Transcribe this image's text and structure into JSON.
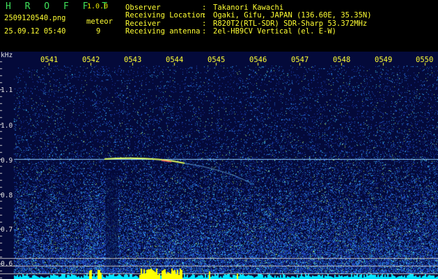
{
  "app": {
    "name": "H R O F F T",
    "version": "1.0.0"
  },
  "file": {
    "name": "2509120540.png",
    "datetime": "25.09.12 05:40"
  },
  "meteor": {
    "label": "meteor",
    "count": "9"
  },
  "info": [
    {
      "key": "Observer",
      "sep": ":",
      "value": "Takanori Kawachi"
    },
    {
      "key": "Receiving Location",
      "sep": ":",
      "value": "Ogaki, Gifu, JAPAN (136.60E, 35.35N)"
    },
    {
      "key": "Receiver",
      "sep": ":",
      "value": "R820T2(RTL-SDR) SDR-Sharp 53.372MHz"
    },
    {
      "key": "Receiving antenna",
      "sep": ":",
      "value": "2el-HB9CV Vertical (el. E-W)"
    }
  ],
  "spectrogram": {
    "unit_label": "kHz",
    "time_ticks": [
      "0541",
      "0542",
      "0543",
      "0544",
      "0545",
      "0546",
      "0547",
      "0548",
      "0549",
      "0550"
    ],
    "freq_ticks": [
      "1.1",
      "1.0",
      "0.9",
      "0.8",
      "0.7",
      "0.6"
    ],
    "colors": {
      "background": "#040a3a",
      "carrier": "#8fd0ff",
      "meteor": "#e0ff60",
      "grid": "#c0c0c0",
      "tick": "#ffff33",
      "baseline": "#00e5ff",
      "burst": "#ffff00"
    }
  }
}
